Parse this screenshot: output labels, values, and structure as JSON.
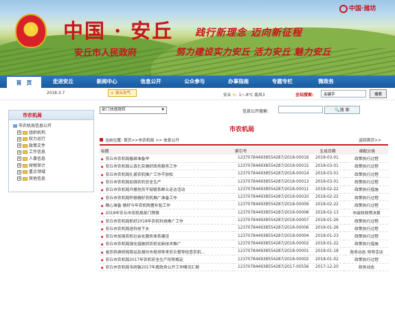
{
  "banner": {
    "title": "中国 · 安丘",
    "gov_name": "安丘市人民政府",
    "slogan1": "践行新理念  迈向新征程",
    "slogan2": "努力建设实力安丘  活力安丘  魅力安丘",
    "logo_text": "中国·潍坊"
  },
  "nav": {
    "items": [
      "首　页",
      "走进安丘",
      "新闻中心",
      "信息公开",
      "公众参与",
      "办事指南",
      "专题专栏",
      "微政务"
    ]
  },
  "infobar": {
    "date": "2018-3-7",
    "weather_button": "安丘天气",
    "weather": "安丘  ⛅ 1~-8℃  南风3",
    "search_label": "全站搜索:",
    "search_value": "关键字",
    "search_button": "搜索"
  },
  "sidebar": {
    "title": "市农机局",
    "items": [
      {
        "label": "市农机局信息公开",
        "level": 0,
        "type": "pc"
      },
      {
        "label": "组织机构",
        "level": 1,
        "type": "folder"
      },
      {
        "label": "权力运行",
        "level": 1,
        "type": "folder"
      },
      {
        "label": "政策文件",
        "level": 1,
        "type": "folder"
      },
      {
        "label": "工作信息",
        "level": 1,
        "type": "folder"
      },
      {
        "label": "人事信息",
        "level": 1,
        "type": "folder"
      },
      {
        "label": "财税审计",
        "level": 1,
        "type": "folder"
      },
      {
        "label": "重点领域",
        "level": 1,
        "type": "folder"
      },
      {
        "label": "其他信息",
        "level": 1,
        "type": "folder"
      }
    ]
  },
  "main": {
    "dept_select": "部门快速跳转",
    "pub_search_label": "信息公开搜索:",
    "pub_search_button": "搜 索",
    "section_title": "市农机局",
    "breadcrumb": "当前位置: 首页>>市农机局 >> 信息公开",
    "back_link": "返回首页>>",
    "columns": [
      "标题",
      "索引号",
      "生成日期",
      "细配分类"
    ],
    "rows": [
      {
        "title": "安丘市农机局春耕准备早",
        "index": "12370784493855428​7/2018-00016",
        "date": "2018-03-01",
        "category": "政策执行过程"
      },
      {
        "title": "安丘市农机局认真扎实做好政务服务工作",
        "index": "1237078449385542​87/2018-00015",
        "date": "2018-03-01",
        "category": "政策执行过程"
      },
      {
        "title": "安丘市农机局扎紧农机推广工作不放松",
        "index": "123707844938554287/2018-00014",
        "date": "2018-03-01",
        "category": "政策执行过程"
      },
      {
        "title": "安丘市农机局加强农机安全生产",
        "index": "123707844938554287/2018-00013",
        "date": "2018-03-01",
        "category": "政策执行过程"
      },
      {
        "title": "安丘市农机局开展党员干部联系群众走访活动",
        "index": "123707844938554287/2018-00011",
        "date": "2018-02-22",
        "category": "政策执行措施"
      },
      {
        "title": "安丘市农机局积极做好农机推广准备工作",
        "index": "123707844938554287/2018-00010",
        "date": "2018-02-22",
        "category": "政策执行过程"
      },
      {
        "title": "精心准备 做好今年农机购置补贴工作",
        "index": "123707844938554287/2018-00009",
        "date": "2018-02-22",
        "category": "政策执行过程"
      },
      {
        "title": "2018年安丘市农机局部门预算",
        "index": "123707844938554287/2018-00008",
        "date": "2018-02-13",
        "category": "市级财政预决算"
      },
      {
        "title": "安丘市农机局抓好2018年农机科技推广工作",
        "index": "123707844938554287/2018-00007",
        "date": "2018-01-26",
        "category": "政策执行过程"
      },
      {
        "title": "安丘市农机局送科技下乡",
        "index": "123707844938554287/2018-00006",
        "date": "2018-01-26",
        "category": "政策执行过程"
      },
      {
        "title": "安丘市加强农机社会化服务体系建设",
        "index": "123707844938554287/2018-00004",
        "date": "2018-01-23",
        "category": "政策执行过程"
      },
      {
        "title": "安丘市农机局强化措施抓农机化新技术推广",
        "index": "123707844938554287/2018-00002",
        "date": "2018-01-22",
        "category": "政策执行措施"
      },
      {
        "title": "省农机维修局局站及潍坊市局领导来安丘督导检查农机…",
        "index": "123707844938554287/2018-00001",
        "date": "2018-01-18",
        "category": "政务动态 领导活动"
      },
      {
        "title": "安丘市农机局2017年农机安全生产形势稳定",
        "index": "123707844938554287/2018-00002",
        "date": "2018-01-02",
        "category": "政策执行过程"
      },
      {
        "title": "安丘市农机局韦昕敏2017年度政务公开工作情况汇报",
        "index": "123707844938554287/2017-00556",
        "date": "2017-12-20",
        "category": "政务动态"
      }
    ]
  },
  "colors": {
    "accent": "#c8141b",
    "nav": "#1a5aa0"
  }
}
